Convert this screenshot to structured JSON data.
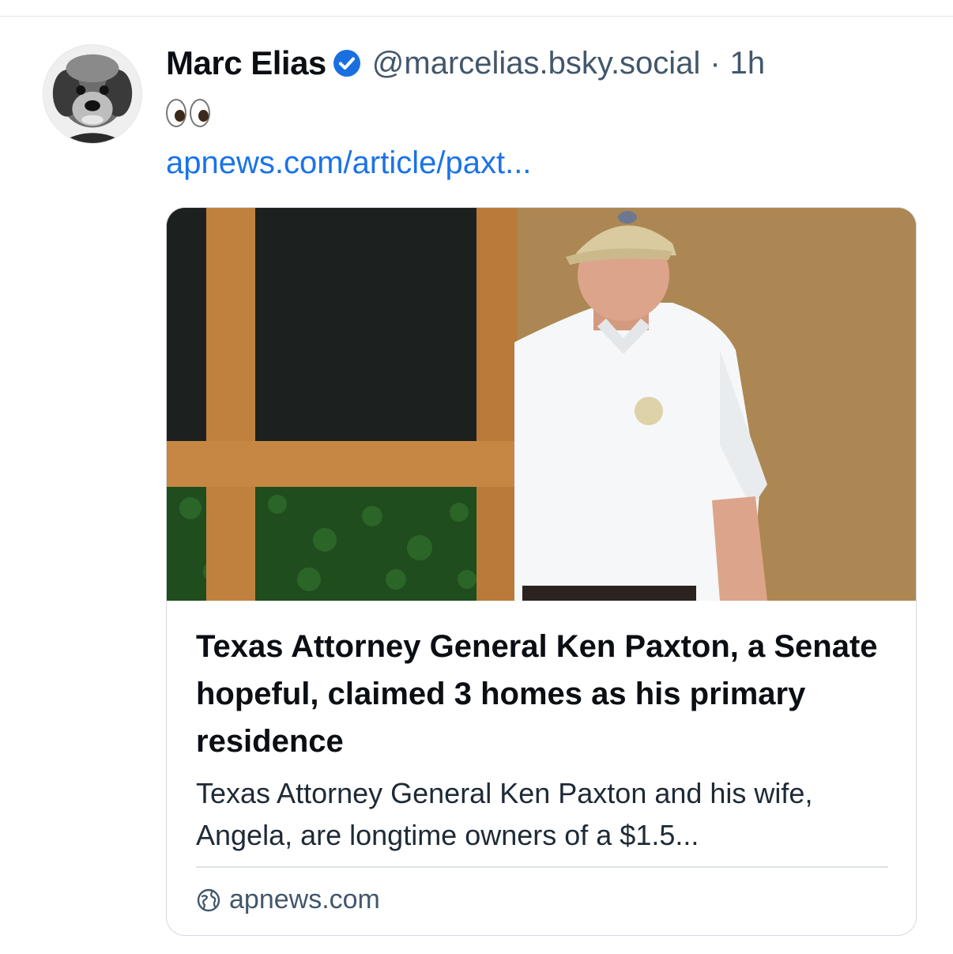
{
  "post": {
    "author_name": "Marc Elias",
    "handle": "@marcelias.bsky.social",
    "separator": "·",
    "time": "1h",
    "emoji_text": "👀",
    "link_text": "apnews.com/article/paxt..."
  },
  "embed": {
    "title": "Texas Attorney General Ken Paxton, a Senate hopeful, claimed 3 homes as his primary residence",
    "description": "Texas Attorney General Ken Paxton and his wife, Angela, are longtime owners of a $1.5...",
    "domain": "apnews.com"
  },
  "icons": {
    "verified": "verified-badge-icon",
    "globe": "globe-icon",
    "eyes": "eyes-emoji"
  },
  "colors": {
    "link": "#1a73e8",
    "muted_text": "#42576c",
    "verified_badge": "#1a6fe0",
    "card_border": "#d4dbe2"
  }
}
